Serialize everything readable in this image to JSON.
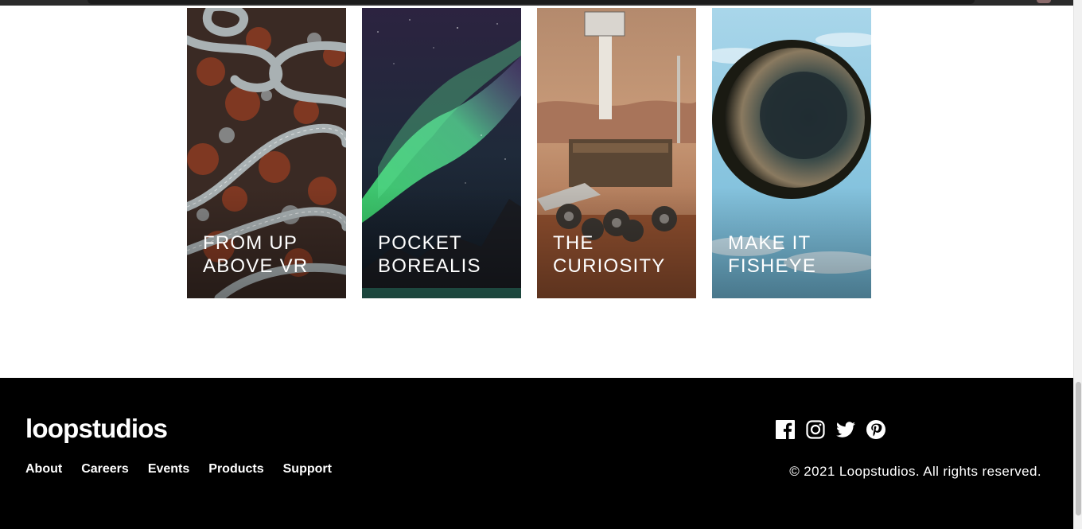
{
  "creations": {
    "items": [
      {
        "title": "FROM UP ABOVE VR"
      },
      {
        "title": "POCKET BOREALIS"
      },
      {
        "title": "THE CURIOSITY"
      },
      {
        "title": "MAKE IT FISHEYE"
      }
    ]
  },
  "footer": {
    "logo": "loopstudios",
    "nav": [
      "About",
      "Careers",
      "Events",
      "Products",
      "Support"
    ],
    "social_icons": [
      "facebook-icon",
      "instagram-icon",
      "twitter-icon",
      "pinterest-icon"
    ],
    "copyright": "© 2021 Loopstudios. All rights reserved."
  },
  "colors": {
    "footer_background": "#000000",
    "text": "#ffffff"
  }
}
